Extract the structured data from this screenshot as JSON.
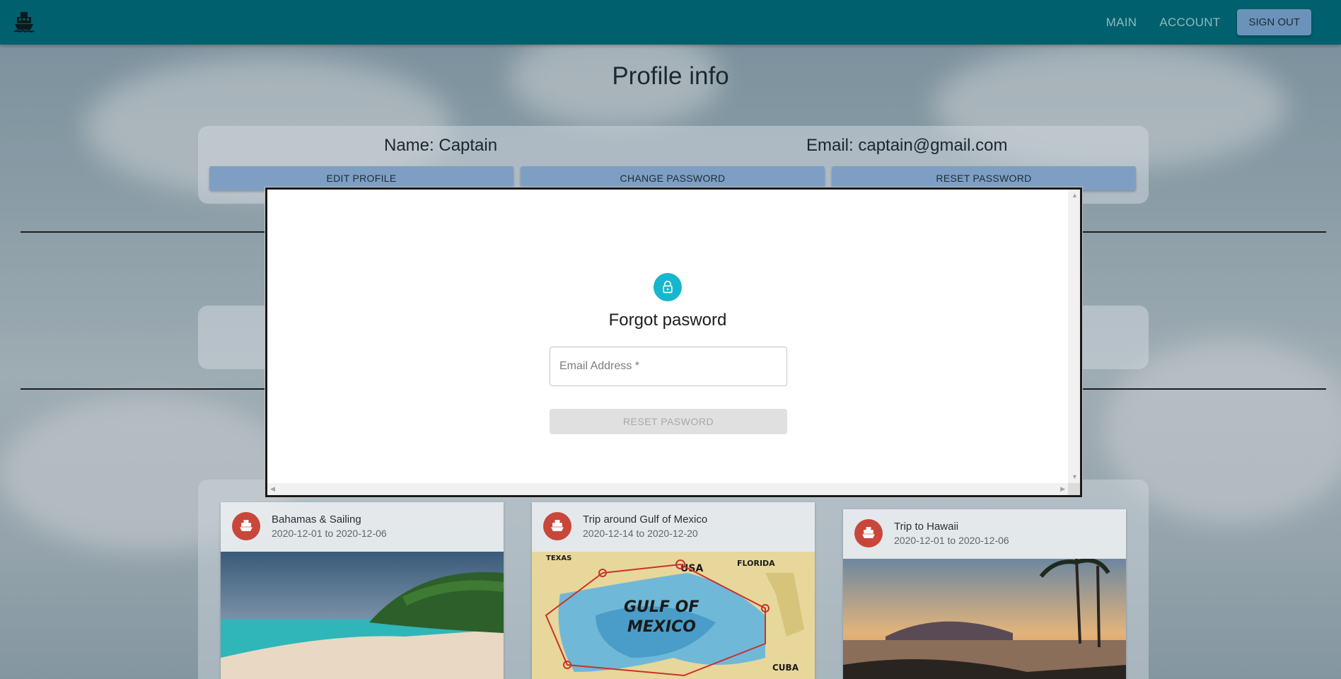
{
  "navbar": {
    "logo_icon": "ship-icon",
    "links": [
      "MAIN",
      "ACCOUNT"
    ],
    "signout_label": "SIGN OUT",
    "color": "#01606d"
  },
  "page_title": "Profile info",
  "profile": {
    "name": "Name: Captain",
    "email": "Email: captain@gmail.com",
    "buttons": [
      "EDIT PROFILE",
      "CHANGE PASSWORD",
      "RESET PASSWORD"
    ]
  },
  "trips": [
    {
      "title": "Bahamas & Sailing",
      "dates": "2020-12-01 to 2020-12-06"
    },
    {
      "title": "Trip around Gulf of Mexico",
      "dates": "2020-12-14 to 2020-12-20"
    },
    {
      "title": "Trip to Hawaii",
      "dates": "2020-12-01 to 2020-12-06"
    }
  ],
  "map_labels": {
    "gulf": "GULF OF",
    "mexico": "MEXICO",
    "usa": "USA",
    "florida": "FLORIDA",
    "texas": "TEXAS",
    "cuba": "CUBA"
  },
  "modal": {
    "icon": "lock-icon",
    "title": "Forgot pasword",
    "email_placeholder": "Email Address *",
    "email_value": "",
    "submit_label": "RESET PASWORD",
    "accent": "#16b6ce"
  }
}
